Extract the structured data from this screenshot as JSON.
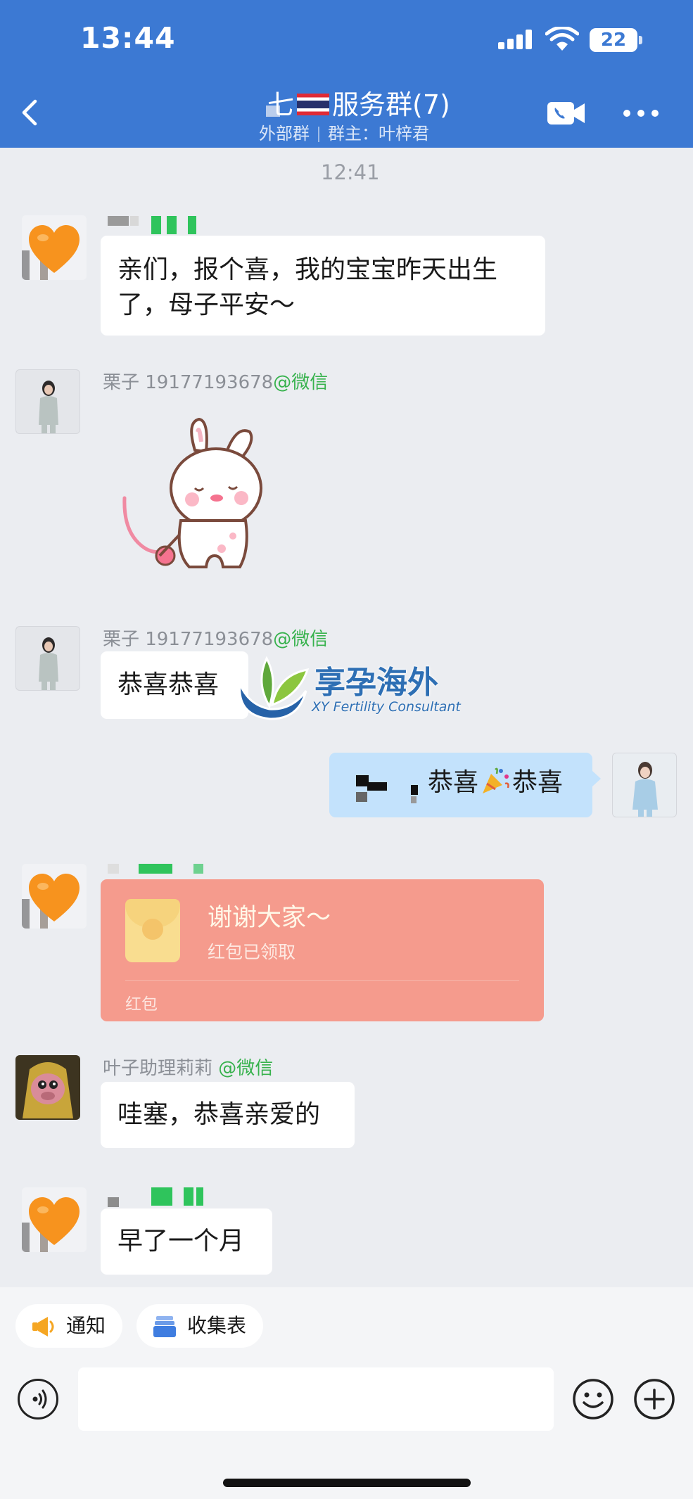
{
  "status_bar": {
    "time": "13:44",
    "battery": "22"
  },
  "header": {
    "title_prefix": "七",
    "title": "服务群(7)",
    "subtitle_left": "外部群",
    "subtitle_right": "群主：叶梓君"
  },
  "chat": {
    "timestamp": "12:41",
    "messages": [
      {
        "type": "text",
        "avatar": "orange-heart",
        "text_line1": "亲们，报个喜，我的宝宝昨天出生",
        "text_line2": "了，母子平安～"
      },
      {
        "type": "sticker",
        "avatar": "photo",
        "sender_name": "栗子 19177193678",
        "sender_suffix": "@微信",
        "sticker": "bunny-sticker"
      },
      {
        "type": "text",
        "avatar": "photo",
        "sender_name": "栗子 19177193678",
        "sender_suffix": "@微信",
        "text": "恭喜恭喜"
      },
      {
        "type": "text",
        "self": true,
        "avatar": "photo",
        "text_a": "恭喜",
        "text_b": "恭喜",
        "emoji": "party-popper"
      },
      {
        "type": "red_packet",
        "avatar": "orange-heart",
        "title": "谢谢大家～",
        "status": "红包已领取",
        "label": "红包"
      },
      {
        "type": "text",
        "avatar": "monkey",
        "sender_name": "叶子助理莉莉",
        "sender_suffix": "@微信",
        "text": "哇塞，恭喜亲爱的"
      },
      {
        "type": "text",
        "avatar": "orange-heart",
        "text": "早了一个月"
      }
    ]
  },
  "watermark": {
    "title": "享孕海外",
    "subtitle": "XY Fertility Consultant"
  },
  "toolbar": {
    "chips": [
      {
        "label": "通知",
        "icon": "megaphone-icon"
      },
      {
        "label": "收集表",
        "icon": "stack-icon"
      }
    ]
  },
  "colors": {
    "header_bg": "#3c79d3",
    "self_bubble": "#c3e2fc",
    "red_packet": "#f59b8d",
    "wechat_green": "#37b24d"
  }
}
